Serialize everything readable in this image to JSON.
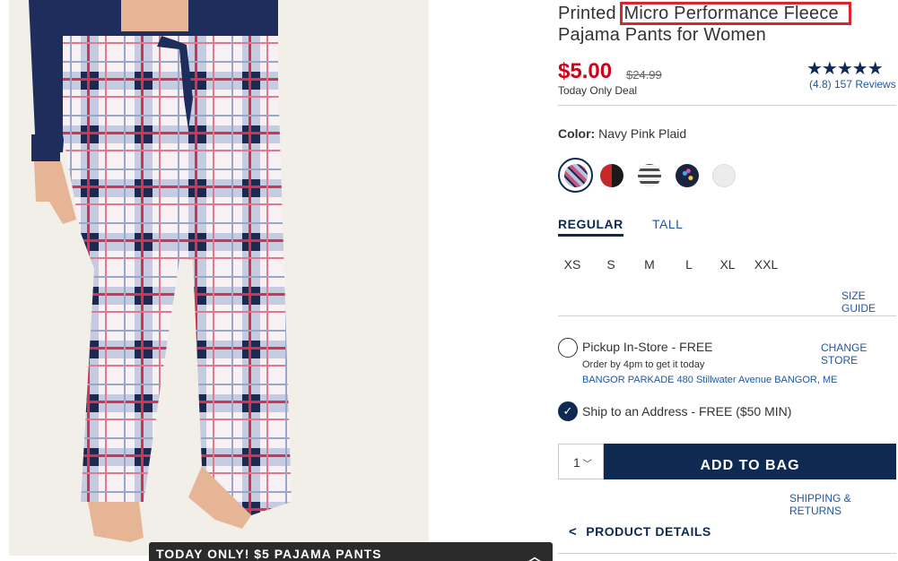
{
  "product": {
    "title_line1_prefix": "Printed ",
    "title_line1_highlight": "Micro Performance Fleece",
    "title_line2": "Pajama Pants for Women",
    "price": "$5.00",
    "original_price": "$24.99",
    "deal_text": "Today Only Deal",
    "rating_stars": "★★★★★",
    "reviews_text": "(4.8) 157 Reviews",
    "rating": 4.8
  },
  "color": {
    "label": "Color:",
    "value": "Navy Pink Plaid",
    "swatches": [
      {
        "name": "navy-pink-plaid",
        "color": "#c9567a",
        "selected": true
      },
      {
        "name": "red-black-plaid",
        "color": "#c62828",
        "selected": false
      },
      {
        "name": "fair-isle",
        "color": "#4a4a4a",
        "selected": false
      },
      {
        "name": "navy-dots",
        "color": "#1a2340",
        "selected": false
      },
      {
        "name": "white-snow",
        "color": "#e8e8e8",
        "selected": false
      }
    ]
  },
  "fit_tabs": {
    "regular": "REGULAR",
    "tall": "TALL"
  },
  "sizes": [
    "XS",
    "S",
    "M",
    "L",
    "XL",
    "XXL"
  ],
  "size_guide": "SIZE GUIDE",
  "fulfillment": {
    "pickup_label": "Pickup In-Store - FREE",
    "change_store": "CHANGE STORE",
    "order_by": "Order by 4pm to get it today",
    "store_address": "BANGOR PARKADE 480 Stillwater Avenue  BANGOR, ME",
    "ship_label": "Ship to an Address - FREE ($50 MIN)"
  },
  "cart": {
    "quantity": "1",
    "add_to_bag": "ADD TO BAG",
    "shipping_returns": "SHIPPING & RETURNS"
  },
  "product_details": "PRODUCT DETAILS",
  "promo_bar": "TODAY ONLY! $5 PAJAMA PANTS",
  "colors": {
    "navy": "#0e2a52",
    "sale_red": "#d0021b",
    "link_blue": "#1f57a4",
    "highlight_red": "#d9262c"
  }
}
